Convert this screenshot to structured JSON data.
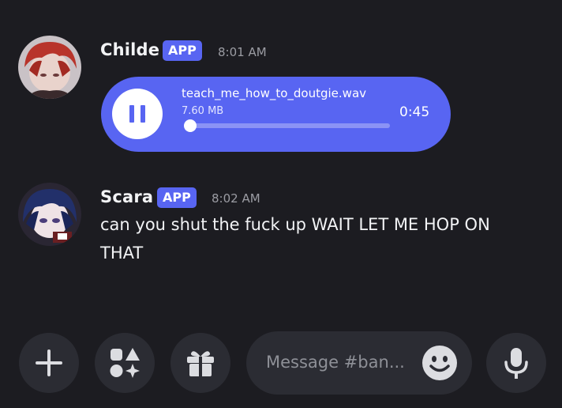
{
  "messages": [
    {
      "author": "Childe",
      "badge": "APP",
      "time": "8:01 AM",
      "attachment": {
        "filename": "teach_me_how_to_doutgie.wav",
        "size": "7.60 MB",
        "duration": "0:45",
        "progress": 0.02,
        "state": "playing"
      }
    },
    {
      "author": "Scara",
      "badge": "APP",
      "time": "8:02 AM",
      "text_line1": "can you shut the fuck up WAIT LET ME HOP ON",
      "text_line2": "THAT"
    }
  ],
  "composer": {
    "placeholder": "Message #ban..."
  },
  "colors": {
    "background": "#1c1c21",
    "accent": "#5865f2",
    "button_bg": "#2b2c33"
  },
  "icons": [
    "plus-icon",
    "apps-icon",
    "gift-icon",
    "emoji-icon",
    "microphone-icon",
    "pause-icon"
  ]
}
